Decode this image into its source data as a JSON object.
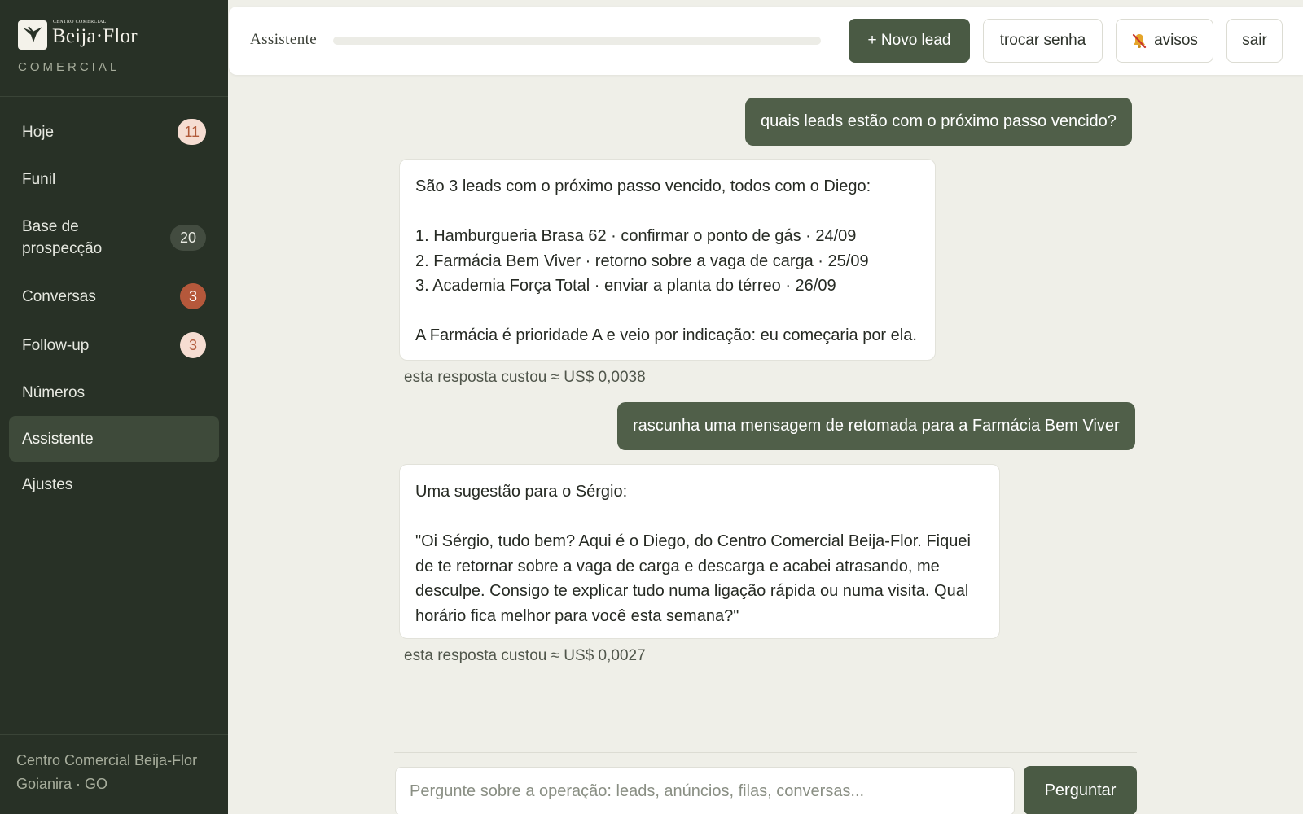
{
  "brand": {
    "small": "CENTRO COMERCIAL",
    "name": "Beija·Flor",
    "sub": "COMERCIAL"
  },
  "sidebar": {
    "items": [
      {
        "label": "Hoje",
        "badge": "11"
      },
      {
        "label": "Funil",
        "badge": ""
      },
      {
        "label": "Base de\nprospecção",
        "badge": "20"
      },
      {
        "label": "Conversas",
        "badge": "3"
      },
      {
        "label": "Follow-up",
        "badge": "3"
      },
      {
        "label": "Números",
        "badge": ""
      },
      {
        "label": "Assistente",
        "badge": "",
        "active": true
      },
      {
        "label": "Ajustes",
        "badge": ""
      }
    ],
    "footer_line1": "Centro Comercial Beija-Flor",
    "footer_line2": "Goianira · GO"
  },
  "topbar": {
    "title": "Assistente",
    "new_lead": "+ Novo lead",
    "change_password": "trocar senha",
    "notices": "avisos",
    "notices_icon": "bell-muted-icon",
    "logout": "sair"
  },
  "chat": {
    "q1": "quais leads estão com o próximo passo vencido?",
    "a1": {
      "intro": "São 3 leads com o próximo passo vencido, todos com o Diego:",
      "list": [
        "1. Hamburgueria Brasa 62 · confirmar o ponto de gás · 24/09",
        "2. Farmácia Bem Viver · retorno sobre a vaga de carga · 25/09",
        "3. Academia Força Total · enviar a planta do térreo · 26/09"
      ],
      "closing": "A Farmácia é prioridade A e veio por indicação: eu começaria por ela."
    },
    "cost1": "esta resposta custou ≈ US$ 0,0038",
    "q2": "rascunha uma mensagem de retomada para a Farmácia Bem Viver",
    "a2": {
      "intro": "Uma sugestão para o Sérgio:",
      "lines": [
        "\"Oi Sérgio, tudo bem? Aqui é o Diego, do Centro Comercial Beija-Flor. Fiquei",
        "de te retornar sobre a vaga de carga e descarga e acabei atrasando, me",
        "desculpe. Consigo te explicar tudo numa ligação rápida ou numa visita. Qual",
        "horário fica melhor para você esta semana?\""
      ]
    },
    "cost2": "esta resposta custou ≈ US$ 0,0027"
  },
  "composer": {
    "placeholder": "Pergunte sobre a operação: leads, anúncios, filas, conversas...",
    "button": "Perguntar"
  },
  "colors": {
    "sidebar_bg": "#283126",
    "accent": "#4a5a44",
    "badge_red": "#b5583b",
    "badge_light": "#f6ddd2",
    "page_bg": "#efefe8"
  }
}
